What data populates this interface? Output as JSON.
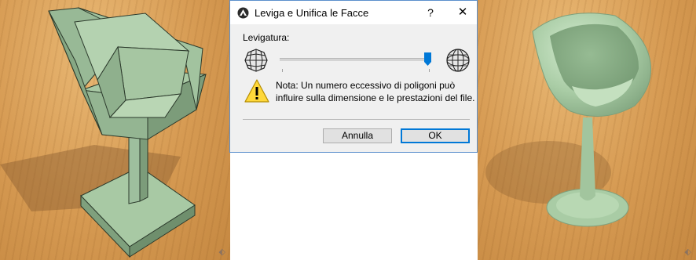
{
  "dialog": {
    "title": "Leviga e Unifica le Facce",
    "help_label": "?",
    "close_label": "✕",
    "smoothing_label": "Levigatura:",
    "smoothing_level": 0.98,
    "note_line1": "Nota: Un numero eccessivo di poligoni può",
    "note_line2": "influire sulla dimensione e le prestazioni del file.",
    "cancel_label": "Annulla",
    "ok_label": "OK"
  },
  "icons": {
    "app": "archicad-logo-icon",
    "low_poly": "low-poly-globe-icon",
    "high_poly": "smooth-globe-icon",
    "warning": "warning-icon",
    "nav": "navigation-cube-icon"
  },
  "viewports": {
    "nav_glyph": "⬖"
  },
  "colors": {
    "accent": "#0078d7",
    "dialog_border": "#5b8fcc",
    "floor": "#d69a52",
    "model": "#9ebf9e",
    "warning": "#ffd83a"
  }
}
